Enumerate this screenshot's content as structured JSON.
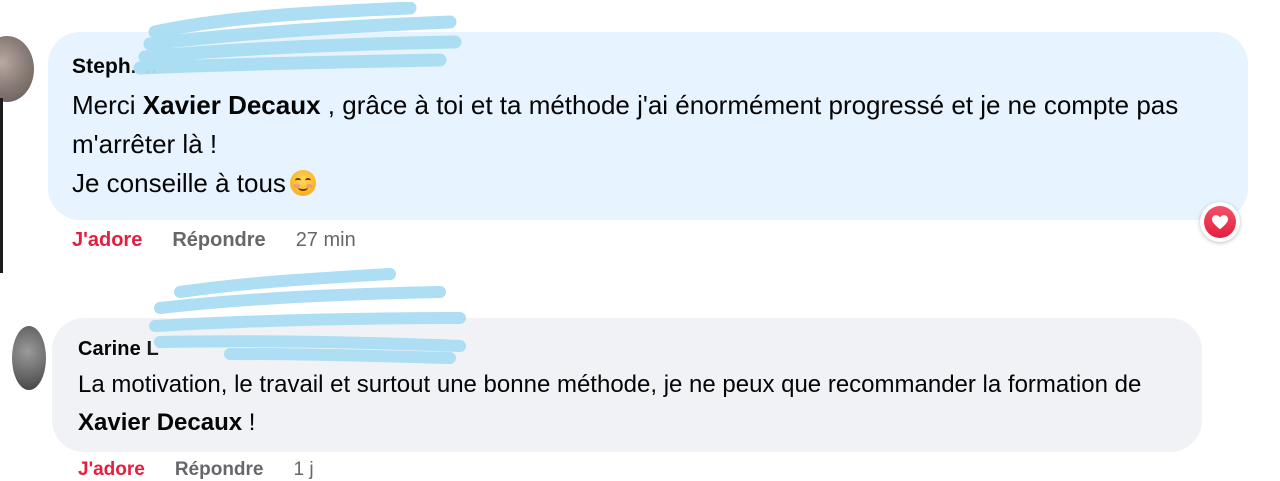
{
  "comments": [
    {
      "author_visible": "Steph",
      "text_before": "Merci ",
      "mention": "Xavier Decaux",
      "text_after": " , grâce à toi et ta méthode j'ai énormément progressé et je ne compte pas m'arrêter là !",
      "line2": "Je conseille à tous",
      "emoji": "smiling-face-icon",
      "like_label": "J'adore",
      "reply_label": "Répondre",
      "time": "27 min",
      "reaction": "love-reaction-icon"
    },
    {
      "author_visible": "Carine",
      "text_before": "La motivation, le travail et surtout une bonne méthode, je ne peux que recommander la formation de ",
      "mention": "Xavier Decaux",
      "text_after": " !",
      "like_label": "J'adore",
      "reply_label": "Répondre",
      "time": "1 j"
    }
  ],
  "colors": {
    "bubble_highlight": "#e7f3ff",
    "bubble_default": "#f0f2f5",
    "like_red": "#e41e3f",
    "redaction_blue": "#a9dcf2"
  }
}
